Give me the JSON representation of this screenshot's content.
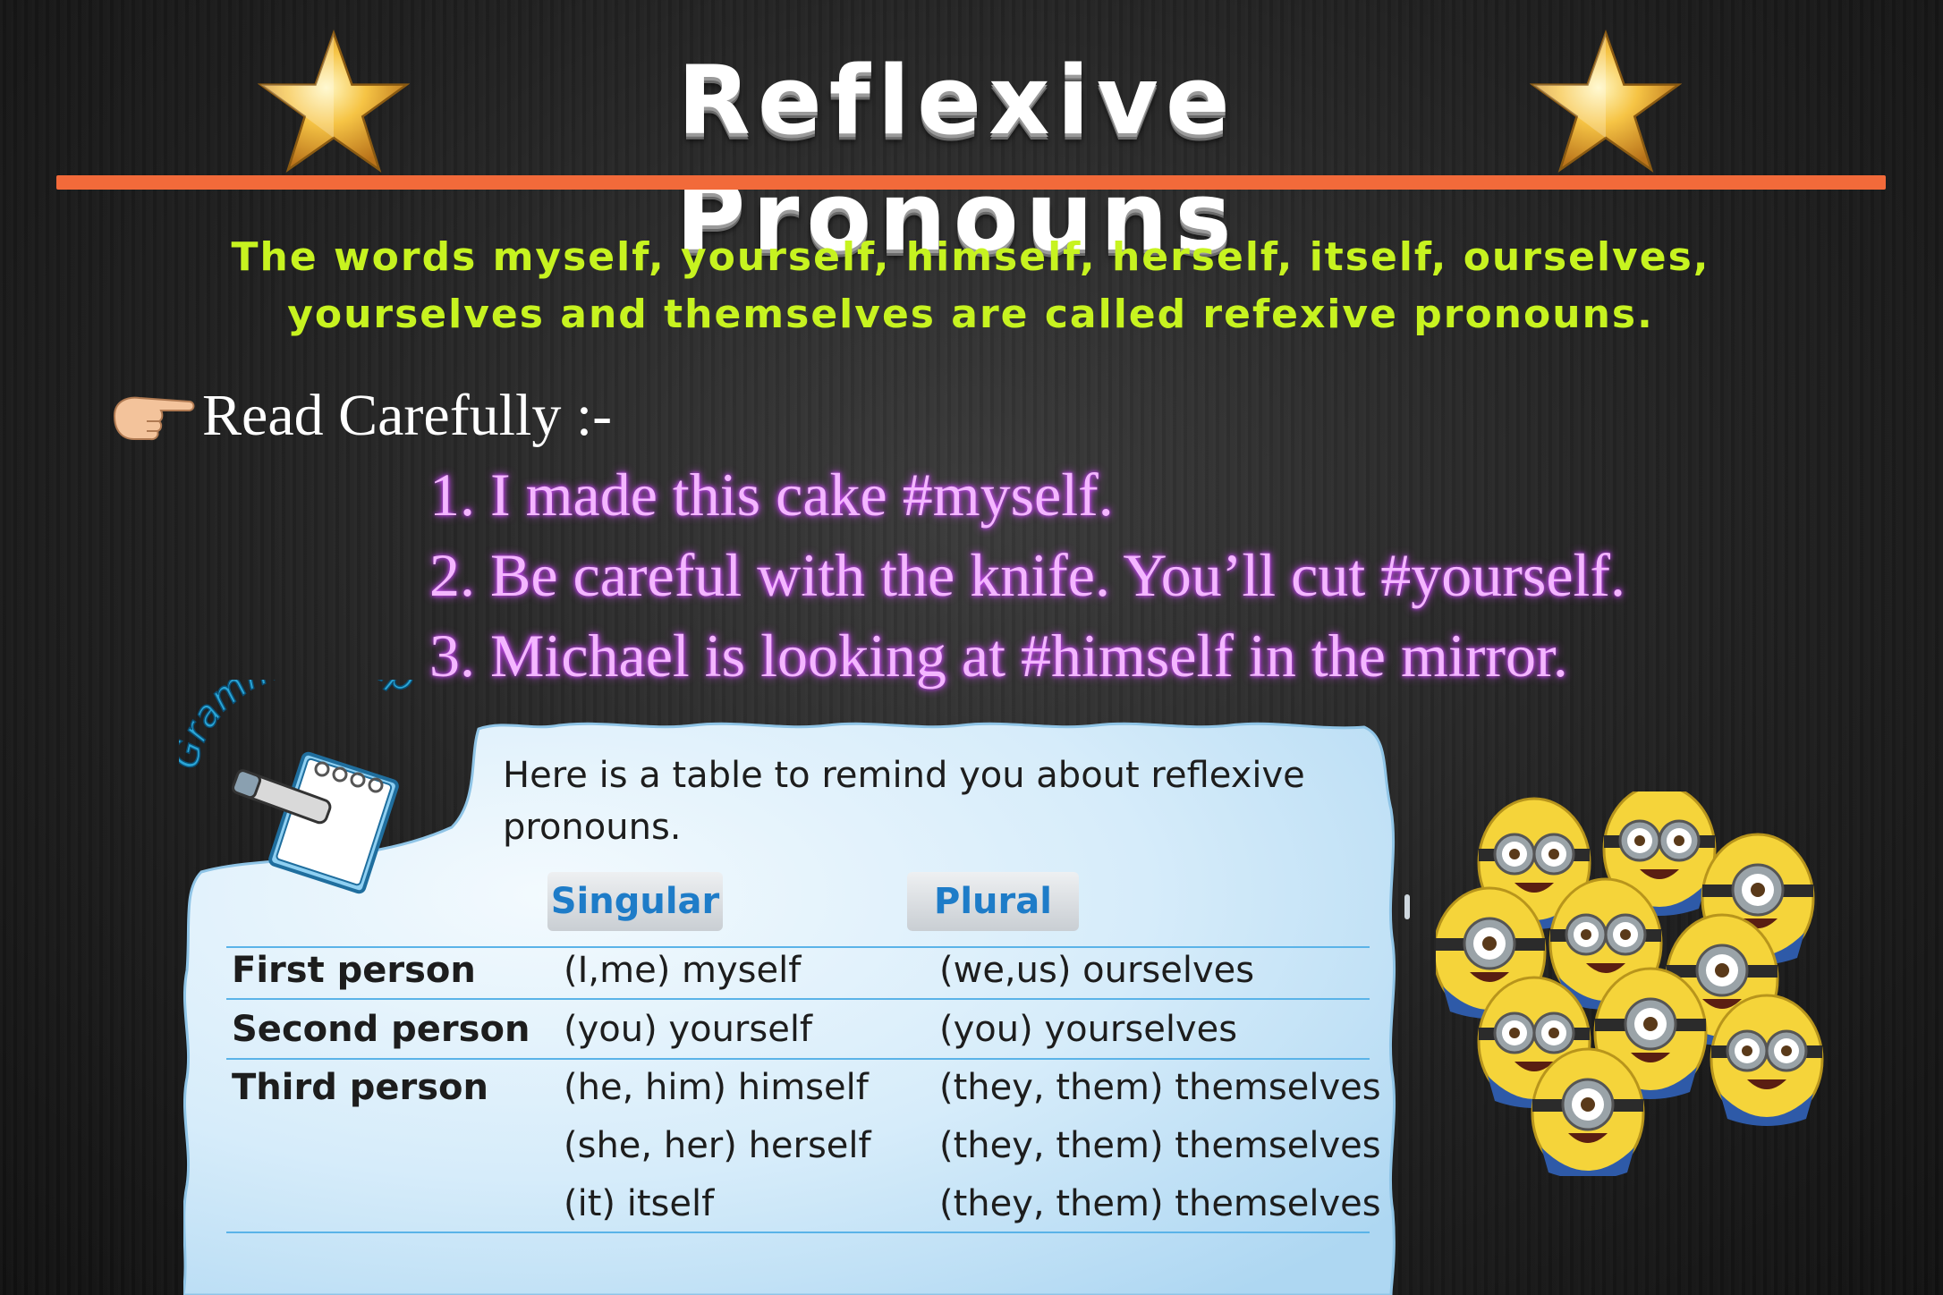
{
  "title": "Reflexive Pronouns",
  "definition_lines": [
    "The words myself, yourself, himself, herself, itself, ourselves,",
    "yourselves and themselves are called refexive pronouns."
  ],
  "read_label": "Read Carefully :-",
  "examples": [
    "1. I made this cake #myself.",
    "2. Be careful with the knife.  You’ll cut #yourself.",
    "3. Michael is looking at #himself in the mirror."
  ],
  "grammar_help": {
    "badge_text": "Grammar Help",
    "intro_lines": [
      "Here is a table to remind you about reflexive",
      "pronouns."
    ],
    "headers": {
      "singular": "Singular",
      "plural": "Plural"
    },
    "rows": [
      {
        "person": "First person",
        "singular": "(I,me) myself",
        "plural": "(we,us) ourselves"
      },
      {
        "person": "Second person",
        "singular": "(you) yourself",
        "plural": "(you) yourselves"
      },
      {
        "person": "Third person",
        "singular": "(he, him) himself",
        "plural": "(they, them) themselves"
      },
      {
        "person": "",
        "singular": "(she, her) herself",
        "plural": "(they, them) themselves"
      },
      {
        "person": "",
        "singular": "(it) itself",
        "plural": "(they, them) themselves"
      }
    ]
  },
  "colors": {
    "accent_rule": "#f26a3a",
    "definition_text": "#c7f320",
    "example_text": "#f4b6ff",
    "table_header": "#1e7cc8",
    "panel_bg": "#d6ecfa"
  },
  "icons": [
    "star-icon",
    "pointing-hand-icon",
    "notepad-pencil-icon",
    "minions-illustration"
  ]
}
